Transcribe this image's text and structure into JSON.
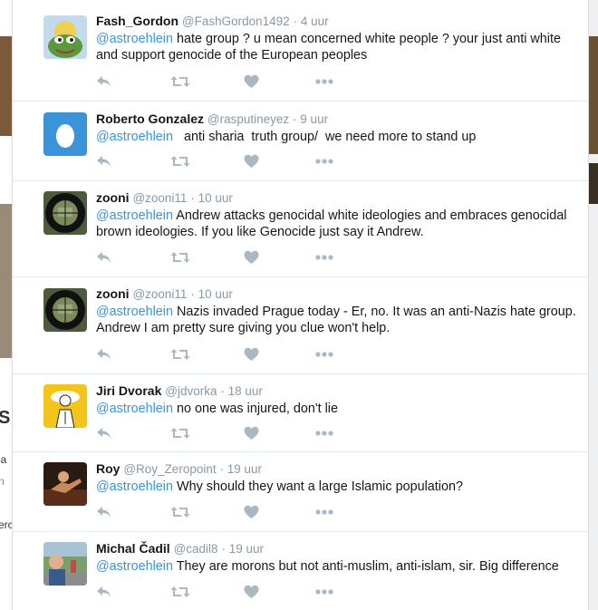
{
  "background": {
    "left_text_fragments": [
      "S",
      "ia",
      "n",
      "erc"
    ]
  },
  "tweets": [
    {
      "fullname": "Fash_Gordon",
      "handle": "@FashGordon1492",
      "time": "4 uur",
      "mention": "@astroehlein",
      "text": " hate group ? u mean concerned white people ? your just anti white and support genocide of the European peoples",
      "avatar": "frog-avatar"
    },
    {
      "fullname": "Roberto Gonzalez",
      "handle": "@rasputineyez",
      "time": "9 uur",
      "mention": "@astroehlein",
      "text": "   anti sharia  truth group/  we need more to stand up",
      "avatar": "default-egg-avatar"
    },
    {
      "fullname": "zooni",
      "handle": "@zooni11",
      "time": "10 uur",
      "mention": "@astroehlein",
      "text": " Andrew attacks genocidal white ideologies and embraces genocidal brown ideologies. If you like Genocide just say it Andrew.",
      "avatar": "scope-avatar"
    },
    {
      "fullname": "zooni",
      "handle": "@zooni11",
      "time": "10 uur",
      "mention": "@astroehlein",
      "text": " Nazis invaded Prague today - Er, no. It was an anti-Nazis hate group. Andrew I am pretty sure giving you clue won't help.",
      "avatar": "scope-avatar"
    },
    {
      "fullname": "Jiri Dvorak",
      "handle": "@jdvorka",
      "time": "18 uur",
      "mention": "@astroehlein",
      "text": " no one was injured, don't lie",
      "avatar": "cartoon-avatar"
    },
    {
      "fullname": "Roy",
      "handle": "@Roy_Zeropoint",
      "time": "19 uur",
      "mention": "@astroehlein",
      "text": " Why should they want a large Islamic population?",
      "avatar": "photo-avatar"
    },
    {
      "fullname": "Michal Čadil",
      "handle": "@cadil8",
      "time": "19 uur",
      "mention": "@astroehlein",
      "text": " They are morons but not anti-muslim, anti-islam, sir. Big difference",
      "avatar": "outdoor-avatar"
    }
  ],
  "colors": {
    "name": "#14171a",
    "meta": "#8899a6",
    "mention": "#3b94d9",
    "action_icon": "#aab8c2",
    "divider": "#e1e8ed"
  },
  "icons": [
    "reply-icon",
    "retweet-icon",
    "like-icon",
    "more-icon"
  ]
}
